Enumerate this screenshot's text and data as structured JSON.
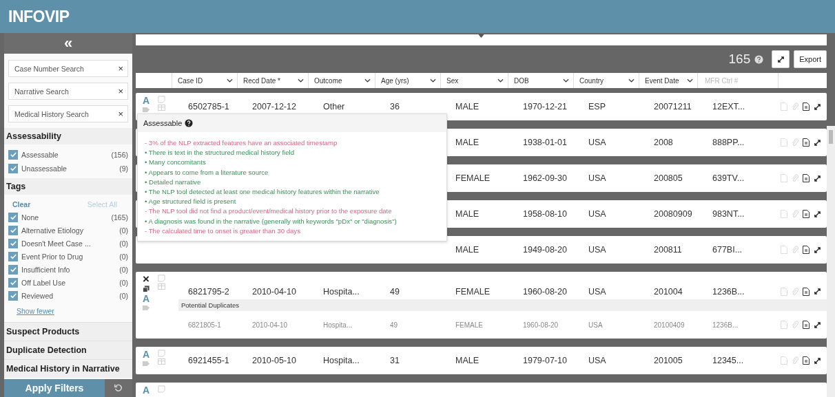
{
  "app": {
    "logo": "INFOVIP"
  },
  "sidebar": {
    "collapse": "«",
    "searches": [
      {
        "placeholder": "Case Number Search",
        "clear": "×"
      },
      {
        "placeholder": "Narrative Search",
        "clear": "×"
      },
      {
        "placeholder": "Medical History Search",
        "clear": "×"
      }
    ],
    "assessability": {
      "title": "Assessability",
      "items": [
        {
          "label": "Assessable",
          "count": "(156)",
          "checked": true
        },
        {
          "label": "Unassessable",
          "count": "(9)",
          "checked": true
        }
      ]
    },
    "tags": {
      "title": "Tags",
      "clear": "Clear",
      "select_all": "Select All",
      "items": [
        {
          "label": "None",
          "count": "(165)",
          "checked": true
        },
        {
          "label": "Alternative Etiology",
          "count": "(0)",
          "checked": true
        },
        {
          "label": "Doesn't Meet Case ...",
          "count": "(0)",
          "checked": true
        },
        {
          "label": "Event Prior to Drug",
          "count": "(0)",
          "checked": true
        },
        {
          "label": "Insufficient Info",
          "count": "(0)",
          "checked": true
        },
        {
          "label": "Off Label Use",
          "count": "(0)",
          "checked": true
        },
        {
          "label": "Reviewed",
          "count": "(0)",
          "checked": true
        }
      ],
      "show_fewer": "Show fewer"
    },
    "sections": [
      "Suspect Products",
      "Duplicate Detection",
      "Medical History in Narrative"
    ],
    "apply": "Apply Filters"
  },
  "toolbar": {
    "count": "165",
    "export": "Export"
  },
  "columns": [
    {
      "label": "Case ID",
      "kind": "sort"
    },
    {
      "label": "Recd Date *",
      "kind": "sort"
    },
    {
      "label": "Outcome",
      "kind": "sort"
    },
    {
      "label": "Age (yrs)",
      "kind": "sort"
    },
    {
      "label": "Sex",
      "kind": "sort"
    },
    {
      "label": "DOB",
      "kind": "sort"
    },
    {
      "label": "Country",
      "kind": "sort"
    },
    {
      "label": "Event Date",
      "kind": "sort"
    },
    {
      "placeholder": "MFR Ctrl #",
      "kind": "filter"
    }
  ],
  "rows": [
    {
      "kind": "normal",
      "assess": "A",
      "cells": [
        "6502785-1",
        "2007-12-12",
        "Other",
        "36",
        "MALE",
        "1970-12-21",
        "ESP",
        "20071211",
        "12EXT..."
      ]
    },
    {
      "kind": "normal",
      "cells": [
        "MALE",
        "1938-01-01",
        "USA",
        "2008",
        "888PP..."
      ]
    },
    {
      "kind": "normal",
      "cells": [
        "FEMALE",
        "1962-09-30",
        "USA",
        "200805",
        "639TV..."
      ]
    },
    {
      "kind": "normal",
      "cells": [
        "MALE",
        "1958-08-10",
        "USA",
        "20080909",
        "983NT..."
      ]
    },
    {
      "kind": "normal",
      "cells": [
        "MALE",
        "1949-08-20",
        "USA",
        "200811",
        "677BI..."
      ]
    },
    {
      "kind": "duplicate",
      "dismiss": "×",
      "assess": "A",
      "cells": [
        "6821795-2",
        "2010-04-10",
        "Hospita...",
        "49",
        "FEMALE",
        "1960-08-20",
        "USA",
        "201004",
        "1236B..."
      ],
      "duplicates_title": "Potential Duplicates",
      "duplicates": [
        [
          "6821805-1",
          "2010-04-10",
          "Hospita...",
          "49",
          "FEMALE",
          "1960-08-20",
          "USA",
          "20100409",
          "1236B..."
        ]
      ]
    },
    {
      "kind": "normal",
      "assess": "A",
      "cells": [
        "6921455-1",
        "2010-05-10",
        "Hospita...",
        "31",
        "MALE",
        "1979-07-10",
        "USA",
        "201005",
        "12345..."
      ]
    },
    {
      "kind": "partial",
      "assess": "A",
      "cells": []
    }
  ],
  "popup": {
    "title": "Assessable",
    "items": [
      {
        "kind": "negative",
        "text": "- 3% of the NLP extracted features have an associated timestamp"
      },
      {
        "kind": "positive",
        "text": "• There is text in the structured medical history field"
      },
      {
        "kind": "positive",
        "text": "• Many concomitants"
      },
      {
        "kind": "positive",
        "text": "• Appears to come from a literature source"
      },
      {
        "kind": "positive",
        "text": "• Detailed narrative"
      },
      {
        "kind": "positive",
        "text": "• The NLP tool detected at least one medical history features within the narrative"
      },
      {
        "kind": "positive",
        "text": "• Age structured field is present"
      },
      {
        "kind": "negative",
        "text": "- The NLP tool did not find a product/event/medical history prior to the exposure date"
      },
      {
        "kind": "positive",
        "text": "• A diagnosis was found in the narrative (generally with keywords \"pDx\" or \"diagnosis\")"
      },
      {
        "kind": "negative",
        "text": "- The calculated time to onset is greater than 30 days"
      }
    ]
  }
}
